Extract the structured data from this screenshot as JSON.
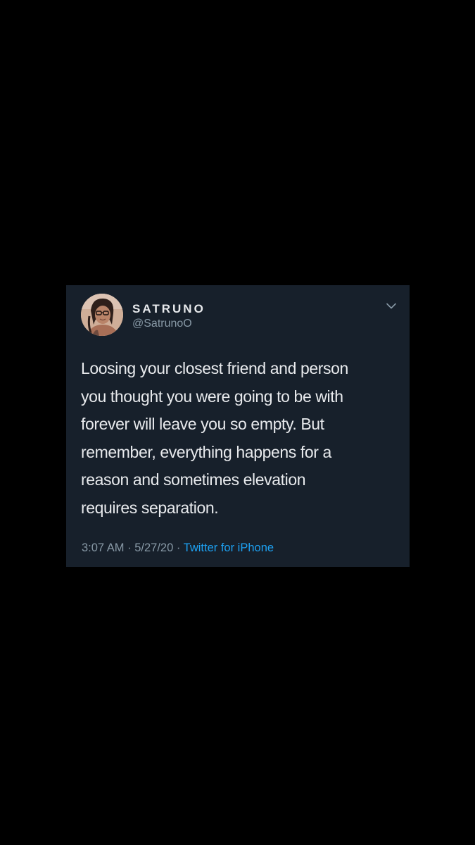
{
  "tweet": {
    "display_name": "SATRUNO",
    "handle": "@SatrunoO",
    "text_lines": [
      "Loosing your closest friend and person",
      "you thought you were going to be with",
      "forever will leave you so empty. But",
      "remember, everything happens for a",
      "reason and sometimes elevation",
      "requires separation."
    ],
    "time": "3:07 AM",
    "separator": " · ",
    "date": "5/27/20",
    "source": "Twitter for iPhone",
    "avatar_icon": "profile-photo",
    "menu_icon": "chevron-down-icon"
  },
  "colors": {
    "page_background": "#000000",
    "card_background": "#17202b",
    "primary_text": "#e8eaed",
    "secondary_text": "#8899a6",
    "link": "#1da1f2"
  }
}
